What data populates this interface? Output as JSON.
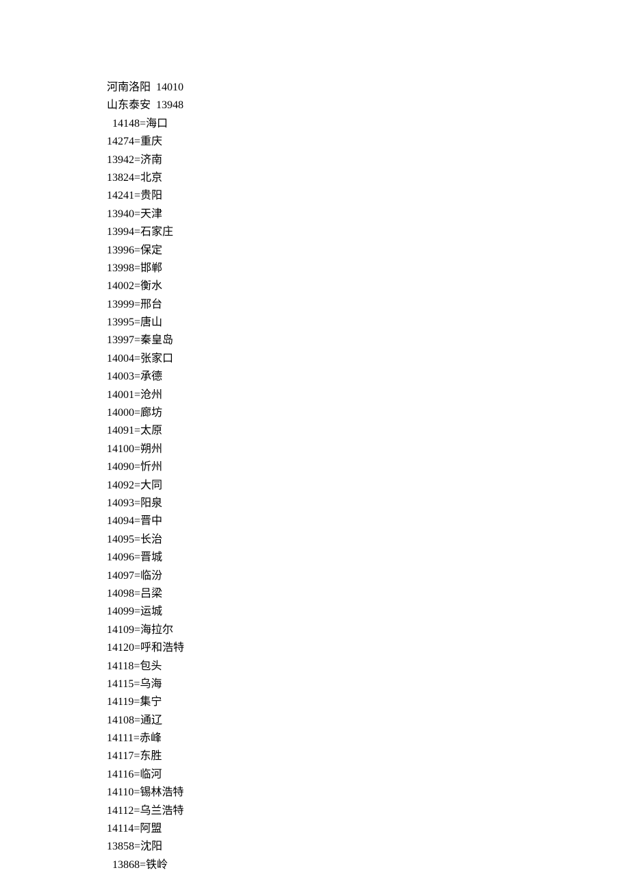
{
  "lines": [
    {
      "text": "河南洛阳  14010",
      "indent": 0
    },
    {
      "text": "山东泰安  13948",
      "indent": 0
    },
    {
      "text": "14148=海口",
      "indent": 1
    },
    {
      "text": "14274=重庆",
      "indent": 0
    },
    {
      "text": "13942=济南",
      "indent": 0
    },
    {
      "text": "13824=北京",
      "indent": 0
    },
    {
      "text": "14241=贵阳",
      "indent": 0
    },
    {
      "text": "13940=天津",
      "indent": 0
    },
    {
      "text": "13994=石家庄",
      "indent": 0
    },
    {
      "text": "13996=保定",
      "indent": 0
    },
    {
      "text": "13998=邯郸",
      "indent": 0
    },
    {
      "text": "14002=衡水",
      "indent": 0
    },
    {
      "text": "13999=邢台",
      "indent": 0
    },
    {
      "text": "13995=唐山",
      "indent": 0
    },
    {
      "text": "13997=秦皇岛",
      "indent": 0
    },
    {
      "text": "14004=张家口",
      "indent": 0
    },
    {
      "text": "14003=承德",
      "indent": 0
    },
    {
      "text": "14001=沧州",
      "indent": 0
    },
    {
      "text": "14000=廊坊",
      "indent": 0
    },
    {
      "text": "14091=太原",
      "indent": 0
    },
    {
      "text": "14100=朔州",
      "indent": 0
    },
    {
      "text": "14090=忻州",
      "indent": 0
    },
    {
      "text": "14092=大同",
      "indent": 0
    },
    {
      "text": "14093=阳泉",
      "indent": 0
    },
    {
      "text": "14094=晋中",
      "indent": 0
    },
    {
      "text": "14095=长治",
      "indent": 0
    },
    {
      "text": "14096=晋城",
      "indent": 0
    },
    {
      "text": "14097=临汾",
      "indent": 0
    },
    {
      "text": "14098=吕梁",
      "indent": 0
    },
    {
      "text": "14099=运城",
      "indent": 0
    },
    {
      "text": "14109=海拉尔",
      "indent": 0
    },
    {
      "text": "14120=呼和浩特",
      "indent": 0
    },
    {
      "text": "14118=包头",
      "indent": 0
    },
    {
      "text": "14115=乌海",
      "indent": 0
    },
    {
      "text": "14119=集宁",
      "indent": 0
    },
    {
      "text": "14108=通辽",
      "indent": 0
    },
    {
      "text": "14111=赤峰",
      "indent": 0
    },
    {
      "text": "14117=东胜",
      "indent": 0
    },
    {
      "text": "14116=临河",
      "indent": 0
    },
    {
      "text": "14110=锡林浩特",
      "indent": 0
    },
    {
      "text": "14112=乌兰浩特",
      "indent": 0
    },
    {
      "text": "14114=阿盟",
      "indent": 0
    },
    {
      "text": "13858=沈阳",
      "indent": 0
    },
    {
      "text": "13868=铁岭",
      "indent": 1
    }
  ]
}
